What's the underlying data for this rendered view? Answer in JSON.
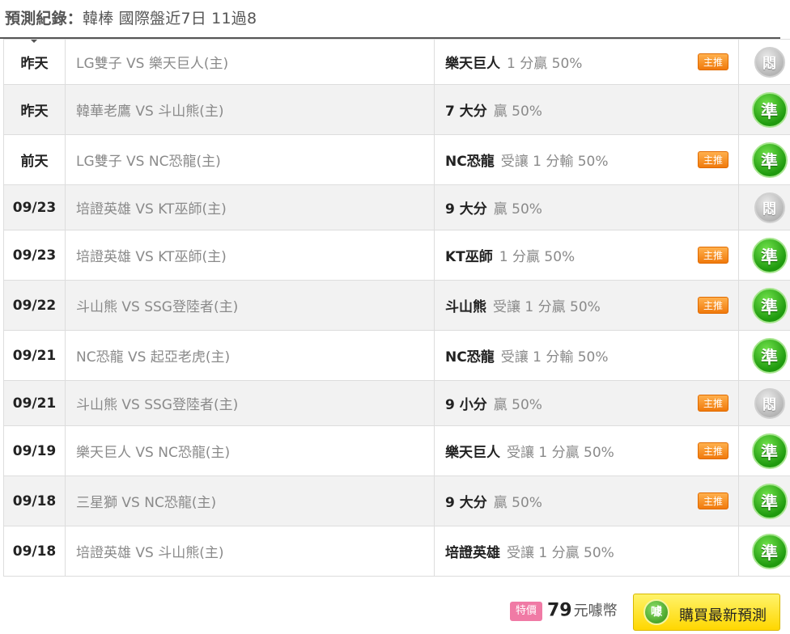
{
  "header": {
    "label": "預測紀錄：",
    "text": "韓棒 國際盤近7日 11過8"
  },
  "rows": [
    {
      "date": "昨天",
      "match": "LG雙子 VS 樂天巨人(主)",
      "pick": "樂天巨人",
      "detail": "1 分贏 50%",
      "tag": "主推",
      "result": "悶"
    },
    {
      "date": "昨天",
      "match": "韓華老鷹 VS 斗山熊(主)",
      "pick": "7 大分",
      "detail": "贏 50%",
      "tag": "",
      "result": "準"
    },
    {
      "date": "前天",
      "match": "LG雙子 VS NC恐龍(主)",
      "pick": "NC恐龍",
      "detail": "受讓 1 分輸 50%",
      "tag": "主推",
      "result": "準"
    },
    {
      "date": "09/23",
      "match": "培證英雄 VS KT巫師(主)",
      "pick": "9 大分",
      "detail": "贏 50%",
      "tag": "",
      "result": "悶"
    },
    {
      "date": "09/23",
      "match": "培證英雄 VS KT巫師(主)",
      "pick": "KT巫師",
      "detail": "1 分贏 50%",
      "tag": "主推",
      "result": "準"
    },
    {
      "date": "09/22",
      "match": "斗山熊 VS SSG登陸者(主)",
      "pick": "斗山熊",
      "detail": "受讓 1 分贏 50%",
      "tag": "主推",
      "result": "準"
    },
    {
      "date": "09/21",
      "match": "NC恐龍 VS 起亞老虎(主)",
      "pick": "NC恐龍",
      "detail": "受讓 1 分輸 50%",
      "tag": "",
      "result": "準"
    },
    {
      "date": "09/21",
      "match": "斗山熊 VS SSG登陸者(主)",
      "pick": "9 小分",
      "detail": "贏 50%",
      "tag": "主推",
      "result": "悶"
    },
    {
      "date": "09/19",
      "match": "樂天巨人 VS NC恐龍(主)",
      "pick": "樂天巨人",
      "detail": "受讓 1 分贏 50%",
      "tag": "主推",
      "result": "準"
    },
    {
      "date": "09/18",
      "match": "三星獅 VS NC恐龍(主)",
      "pick": "9 大分",
      "detail": "贏 50%",
      "tag": "主推",
      "result": "準"
    },
    {
      "date": "09/18",
      "match": "培證英雄 VS 斗山熊(主)",
      "pick": "培證英雄",
      "detail": "受讓 1 分贏 50%",
      "tag": "",
      "result": "準"
    }
  ],
  "footer": {
    "special_label": "特價",
    "price": "79",
    "unit": "元噱幣",
    "coin_glyph": "噱",
    "buy_label": "購買最新預測"
  },
  "colors": {
    "win": "#1f9a0e",
    "pending": "#b3b3b3",
    "tag": "#f07a0c",
    "special": "#f07aa5",
    "button": "#ffd700"
  }
}
